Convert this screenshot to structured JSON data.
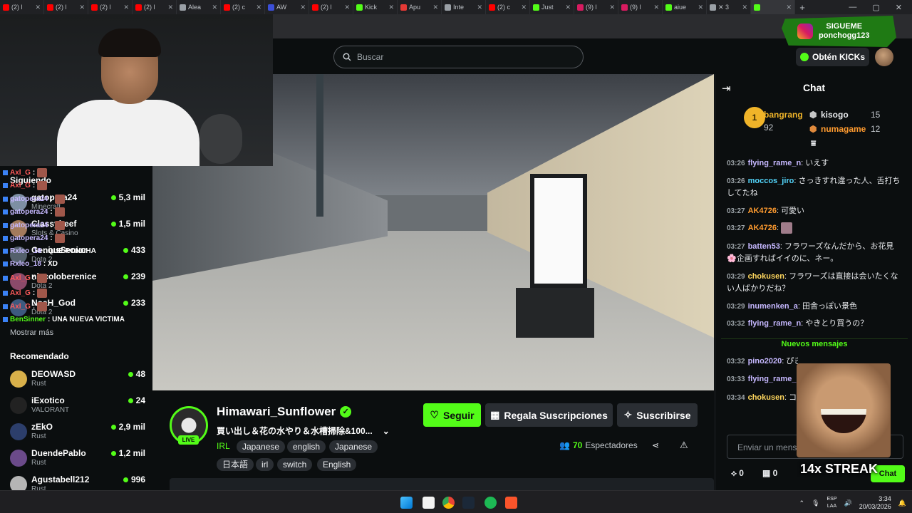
{
  "browser": {
    "tabs": [
      {
        "label": "(2) l",
        "color": "#ff0000"
      },
      {
        "label": "(2) l",
        "color": "#ff0000"
      },
      {
        "label": "(2) l",
        "color": "#ff0000"
      },
      {
        "label": "(2) l",
        "color": "#ff0000"
      },
      {
        "label": "Alea",
        "color": "#9aa0a6"
      },
      {
        "label": "(2) c",
        "color": "#ff0000"
      },
      {
        "label": "AW",
        "color": "#3b4fd8"
      },
      {
        "label": "(2) l",
        "color": "#ff0000"
      },
      {
        "label": "Kick",
        "color": "#53fc18"
      },
      {
        "label": "Apu",
        "color": "#e53935"
      },
      {
        "label": "Inte",
        "color": "#9aa0a6"
      },
      {
        "label": "(2) c",
        "color": "#ff0000"
      },
      {
        "label": "Just",
        "color": "#53fc18"
      },
      {
        "label": "(9) l",
        "color": "#d81b60"
      },
      {
        "label": "(9) l",
        "color": "#d81b60"
      },
      {
        "label": "aiue",
        "color": "#53fc18"
      },
      {
        "label": "✕ 3",
        "color": "#9aa0a6"
      },
      {
        "label": "",
        "color": "#53fc18",
        "active": true
      }
    ],
    "new_tab": "+",
    "win_min": "—",
    "win_max": "▢",
    "win_close": "✕"
  },
  "nav": {
    "search_placeholder": "Buscar",
    "kicks_label": "Obtén KICKs"
  },
  "overlay": {
    "follow_line1": "SIGUEME",
    "follow_line2": "ponchogg123",
    "streak": "14x STREAK",
    "stream_chat": [
      {
        "user": "Axl_G",
        "text": ":",
        "color": "#ff5a5a"
      },
      {
        "user": "Axl_G",
        "text": ":",
        "color": "#ff5a5a"
      },
      {
        "user": "gatopera24",
        "text": ":",
        "color": "#c6b8ff"
      },
      {
        "user": "gatopera24",
        "text": ":",
        "color": "#c6b8ff"
      },
      {
        "user": "gatopera24",
        "text": ":",
        "color": "#c6b8ff"
      },
      {
        "user": "gatopera24",
        "text": ":",
        "color": "#c6b8ff"
      },
      {
        "user": "Rxleo_18",
        "text": ": QUE PONCHA",
        "color": "#c6b8ff"
      },
      {
        "user": "Rxleo_18",
        "text": ": XD",
        "color": "#c6b8ff"
      },
      {
        "user": "Axl_G",
        "text": ":",
        "color": "#ff5a5a"
      },
      {
        "user": "Axl_G",
        "text": ":",
        "color": "#ff5a5a"
      },
      {
        "user": "Axl_G",
        "text": ":",
        "color": "#ff5a5a"
      },
      {
        "user": "BenSinner",
        "text": ": UNA NUEVA VICTIMA",
        "color": "#53fc18"
      }
    ]
  },
  "sidebar": {
    "following_heading": "Siguiendo",
    "following": [
      {
        "name": "gatopera24",
        "category": "Minecraft",
        "viewers": "5,3 mil",
        "color": "#7d8fa3"
      },
      {
        "name": "Classybeef",
        "category": "Slots & Casino",
        "viewers": "1,5 mil",
        "color": "#a37a5c"
      },
      {
        "name": "GeniusSenior",
        "category": "Dota 2",
        "viewers": "433",
        "color": "#54606c"
      },
      {
        "name": "niccoloberenice",
        "category": "Dota 2",
        "viewers": "239",
        "color": "#8a4a6a"
      },
      {
        "name": "NoaH_God",
        "category": "Dota 2",
        "viewers": "233",
        "color": "#3d5a80"
      }
    ],
    "show_more": "Mostrar más",
    "recommended_heading": "Recomendado",
    "recommended": [
      {
        "name": "DEOWASD",
        "category": "Rust",
        "viewers": "48",
        "color": "#d8b04a"
      },
      {
        "name": "iExotico",
        "category": "VALORANT",
        "viewers": "24",
        "color": "#222222"
      },
      {
        "name": "zEkO",
        "category": "Rust",
        "viewers": "2,9 mil",
        "color": "#2c3e6b"
      },
      {
        "name": "DuendePablo",
        "category": "Rust",
        "viewers": "1,2 mil",
        "color": "#6b4a8a"
      },
      {
        "name": "Agustabell212",
        "category": "Rust",
        "viewers": "996",
        "color": "#b5b5b5"
      }
    ]
  },
  "channel": {
    "name": "Himawari_Sunflower",
    "live": "LIVE",
    "title": "買い出し＆花の水やり＆水槽掃除&100...",
    "category": "IRL",
    "tags": [
      "Japanese",
      "english",
      "Japanese",
      "日本語",
      "irl",
      "switch",
      "English"
    ],
    "follow_label": "Seguir",
    "gift_label": "Regala Suscripciones",
    "subscribe_label": "Suscribirse",
    "viewer_count": "70",
    "viewer_label": "Espectadores"
  },
  "chat": {
    "title": "Chat",
    "leaderboard": [
      {
        "rank": "1",
        "name": "bangrang",
        "points": "92"
      },
      {
        "rank": "2",
        "name": "kisogo",
        "points": "15"
      },
      {
        "rank": "3",
        "name": "numagame",
        "points": "12"
      }
    ],
    "messages": [
      {
        "time": "03:26",
        "user": "flying_rame_n",
        "text": "いえす",
        "color": "#c6b8ff"
      },
      {
        "time": "03:26",
        "user": "moccos_jiro",
        "text": "さっきすれ違った人、舌打ちしてたね",
        "color": "#53d6fc"
      },
      {
        "time": "03:27",
        "user": "AK4726",
        "text": "可愛い",
        "color": "#ff9b2f"
      },
      {
        "time": "03:27",
        "user": "AK4726",
        "text": "",
        "color": "#ff9b2f"
      },
      {
        "time": "03:27",
        "user": "batten53",
        "text": "フラワーズなんだから、お花見🌸企画すればイイのに、ネー。",
        "color": "#c6b8ff"
      },
      {
        "time": "03:29",
        "user": "chokusen",
        "text": "フラワーズは直接は会いたくない人ばかりだね？",
        "color": "#ffd75e"
      },
      {
        "time": "03:29",
        "user": "inumenken_a",
        "text": "田舎っぽい景色",
        "color": "#c6b8ff"
      },
      {
        "time": "03:32",
        "user": "flying_rame_n",
        "text": "やきとり買うの？",
        "color": "#c6b8ff"
      }
    ],
    "new_messages_label": "Nuevos mensajes",
    "new_messages": [
      {
        "time": "03:32",
        "user": "pino2020",
        "text": "ぴきちゃまーたよ",
        "color": "#c6b8ff"
      },
      {
        "time": "03:33",
        "user": "flying_rame_",
        "text": "",
        "color": "#c6b8ff"
      },
      {
        "time": "03:34",
        "user": "chokusen",
        "text": "コ",
        "color": "#ffd75e"
      }
    ],
    "input_placeholder": "Enviar un mensaje",
    "kicks_count": "0",
    "gifts_count": "0",
    "send_label": "Chat"
  },
  "taskbar": {
    "lang_line1": "ESP",
    "lang_line2": "LAA",
    "time": "3:34",
    "date": "20/03/2026"
  }
}
